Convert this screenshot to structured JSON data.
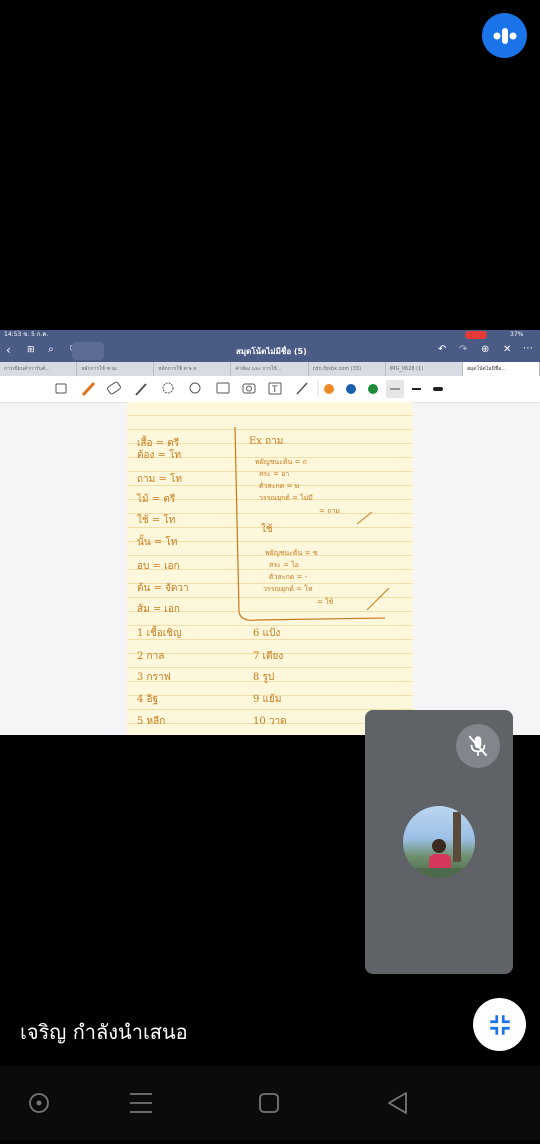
{
  "shared_screen": {
    "status_time": "14:53 ข. 5 ก.ค.",
    "battery": "37%",
    "doc_title": "สมุดโน้ตไม่มีชื่อ (5)",
    "tabs": [
      "การเขียนคำการันต์...",
      "หลักการใช้ ฑ ฒ",
      "หลักการใช้ ศ ษ ส",
      "คำพ้อง และ การใช้...",
      "cdn.fbsbx.com (33)",
      "IMG_0628 (1)",
      "สมุดโน้ตไม่มีชื่อ..."
    ],
    "colors": [
      "#f08a24",
      "#1b5fad",
      "#1f8a3a"
    ]
  },
  "notes": {
    "left": [
      "เสื้อ = ตรี",
      "ต้อง = โท",
      "ถาม = โท",
      "ไม้ = ตรี",
      "ใช้ = โท",
      "นั้น = โท",
      "อบ = เอก",
      "ต้น = จัตวา",
      "ส้ม = เอก"
    ],
    "right": [
      "Ex ถาม",
      "พยัญชนะต้น = ถ",
      "สระ = อา",
      "ตัวสะกด = ม",
      "วรรณยุกต์ = ไม่มี",
      "= ถาม",
      "ใช้",
      "พยัญชนะต้น = ช",
      "สระ = ไอ",
      "ตัวสะกด = -",
      "วรรณยุกต์ = โท",
      "= ใช้"
    ],
    "list_left": [
      "1 เชื้อเชิญ",
      "2 กาล",
      "3 กราฟ",
      "4 อิฐ",
      "5 หลีก"
    ],
    "list_right": [
      "6 แป้ง",
      "7 เตียง",
      "8 รูป",
      "9 แย้ม",
      "10 วาด"
    ]
  },
  "presenter": {
    "label": "เจริญ กำลังนำเสนอ"
  }
}
